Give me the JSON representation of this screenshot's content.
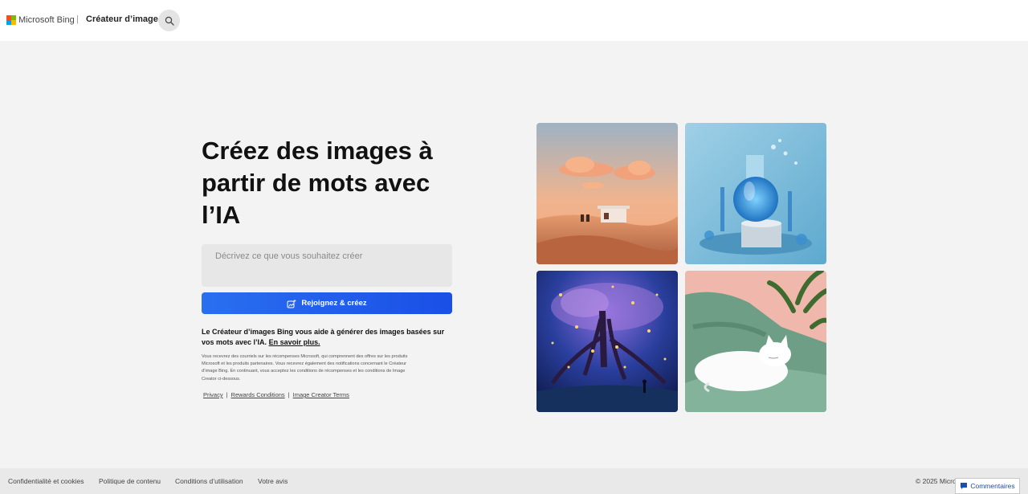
{
  "header": {
    "brand": "Microsoft Bing",
    "separator": "|",
    "app_title": "Créateur d’image",
    "search_icon": "search-icon",
    "logo_colors": [
      "#f25022",
      "#7fba00",
      "#00a4ef",
      "#ffb900"
    ]
  },
  "hero": {
    "title": "Créez des images à partir de mots avec l’IA",
    "prompt_placeholder": "Décrivez ce que vous souhaitez créer",
    "join_button": "Rejoignez & créez",
    "description": "Le Créateur d’images Bing vous aide à générer des images basées sur vos mots avec l’IA.",
    "learn_more": "En savoir plus.",
    "fine_print": "Vous recevrez des courriels sur les récompenses Microsoft, qui comprennent des offres sur les produits Microsoft et les produits partenaires. Vous recevrez également des notifications concernant le Créateur d’image Bing. En continuant, vous acceptez les conditions de récompenses et les conditions de Image Creator ci-dessous.",
    "links": [
      {
        "label": "Privacy"
      },
      {
        "label": "Rewards Conditions"
      },
      {
        "label": "Image Creator Terms"
      }
    ],
    "link_separator": "|",
    "accent_color": "#2563eb"
  },
  "gallery": [
    {
      "subject": "desert-gas-station"
    },
    {
      "subject": "blue-glass-flask"
    },
    {
      "subject": "glowing-tree-night"
    },
    {
      "subject": "white-cat-on-green-sofa"
    }
  ],
  "footer": {
    "links": [
      {
        "label": "Confidentialité et cookies"
      },
      {
        "label": "Politique de contenu"
      },
      {
        "label": "Conditions d’utilisation"
      },
      {
        "label": "Votre avis"
      }
    ],
    "copyright": "© 2025 Microsoft",
    "feedback": "Commentaires"
  }
}
